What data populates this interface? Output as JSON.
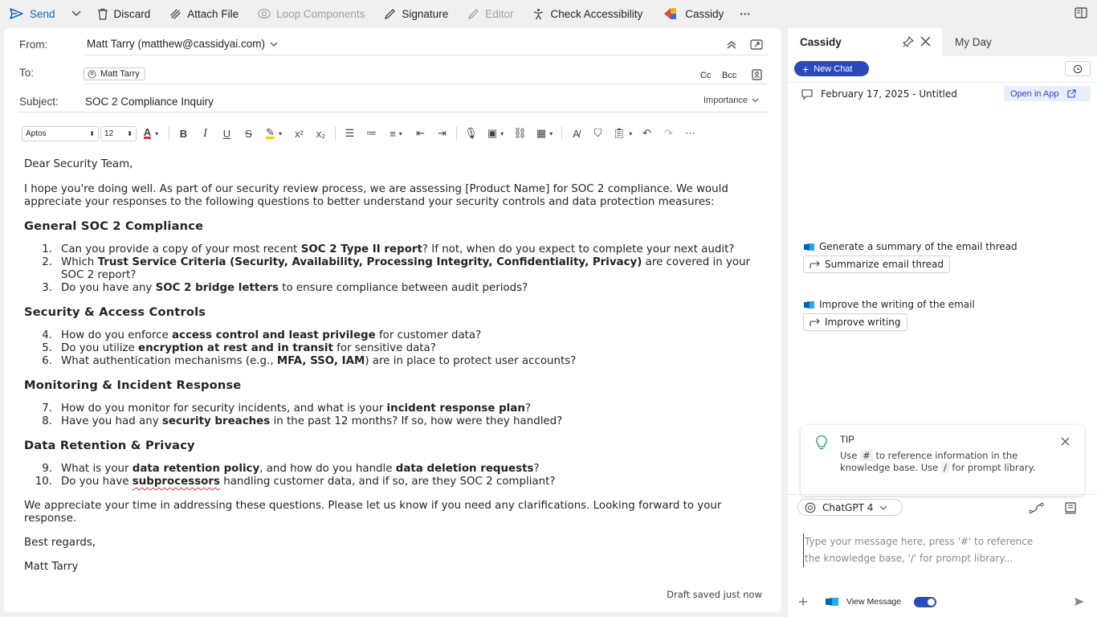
{
  "toolbar": {
    "send": "Send",
    "discard": "Discard",
    "attach": "Attach File",
    "loop": "Loop Components",
    "signature": "Signature",
    "editor": "Editor",
    "accessibility": "Check Accessibility",
    "cassidy": "Cassidy"
  },
  "header": {
    "from_label": "From:",
    "from_value": "Matt Tarry (matthew@cassidyai.com)",
    "to_label": "To:",
    "to_chip": "Matt Tarry",
    "cc": "Cc",
    "bcc": "Bcc",
    "subject_label": "Subject:",
    "subject_value": "SOC 2 Compliance Inquiry",
    "importance": "Importance"
  },
  "format": {
    "font": "Aptos",
    "size": "12"
  },
  "email": {
    "greeting": "Dear Security Team,",
    "intro": "I hope you're doing well. As part of our security review process, we are assessing [Product Name] for SOC 2 compliance. We would appreciate your responses to the following questions to better understand your security controls and data protection measures:",
    "h1": "General SOC 2 Compliance",
    "q1a": "Can you provide a copy of your most recent ",
    "q1b": "SOC 2 Type II report",
    "q1c": "? If not, when do you expect to complete your next audit?",
    "q2a": "Which ",
    "q2b": "Trust Service Criteria (Security, Availability, Processing Integrity, Confidentiality, Privacy)",
    "q2c": " are covered in your SOC 2 report?",
    "q3a": "Do you have any ",
    "q3b": "SOC 2 bridge letters",
    "q3c": " to ensure compliance between audit periods?",
    "h2": "Security & Access Controls",
    "q4a": "How do you enforce ",
    "q4b": "access control and least privilege",
    "q4c": " for customer data?",
    "q5a": "Do you utilize ",
    "q5b": "encryption at rest and in transit",
    "q5c": " for sensitive data?",
    "q6a": "What authentication mechanisms (e.g., ",
    "q6b": "MFA, SSO, IAM",
    "q6c": ") are in place to protect user accounts?",
    "h3": "Monitoring & Incident Response",
    "q7a": "How do you monitor for security incidents, and what is your ",
    "q7b": "incident response plan",
    "q7c": "?",
    "q8a": "Have you had any ",
    "q8b": "security breaches",
    "q8c": " in the past 12 months? If so, how were they handled?",
    "h4": "Data Retention & Privacy",
    "q9a": "What is your ",
    "q9b": "data retention policy",
    "q9c": ", and how do you handle ",
    "q9d": "data deletion requests",
    "q9e": "?",
    "q10a": "Do you have ",
    "q10b": "subprocessors",
    "q10c": " handling customer data, and if so, are they SOC 2 compliant?",
    "closing": "We appreciate your time in addressing these questions. Please let us know if you need any clarifications. Looking forward to your response.",
    "regards": "Best regards,",
    "name": "Matt Tarry",
    "draft": "Draft saved just now"
  },
  "panel": {
    "tab1": "Cassidy",
    "tab2": "My Day",
    "new_chat": "New Chat",
    "chat_title": "February 17, 2025 - Untitled",
    "open_app": "Open in App",
    "p1": "Generate a summary of the email thread",
    "p1_btn": "Summarize email thread",
    "p2": "Improve the writing of the email",
    "p2_btn": "Improve writing",
    "tip_title": "TIP",
    "tip_a": "Use",
    "tip_hash": "#",
    "tip_b": "to reference information in the knowledge base. Use",
    "tip_slash": "/",
    "tip_c": "for prompt library.",
    "model": "ChatGPT 4",
    "input_placeholder": "Type your message here, press '#' to reference the knowledge base, '/' for prompt library...",
    "view_message": "View Message"
  },
  "numbers": [
    "1.",
    "2.",
    "3.",
    "4.",
    "5.",
    "6.",
    "7.",
    "8.",
    "9.",
    "10."
  ]
}
